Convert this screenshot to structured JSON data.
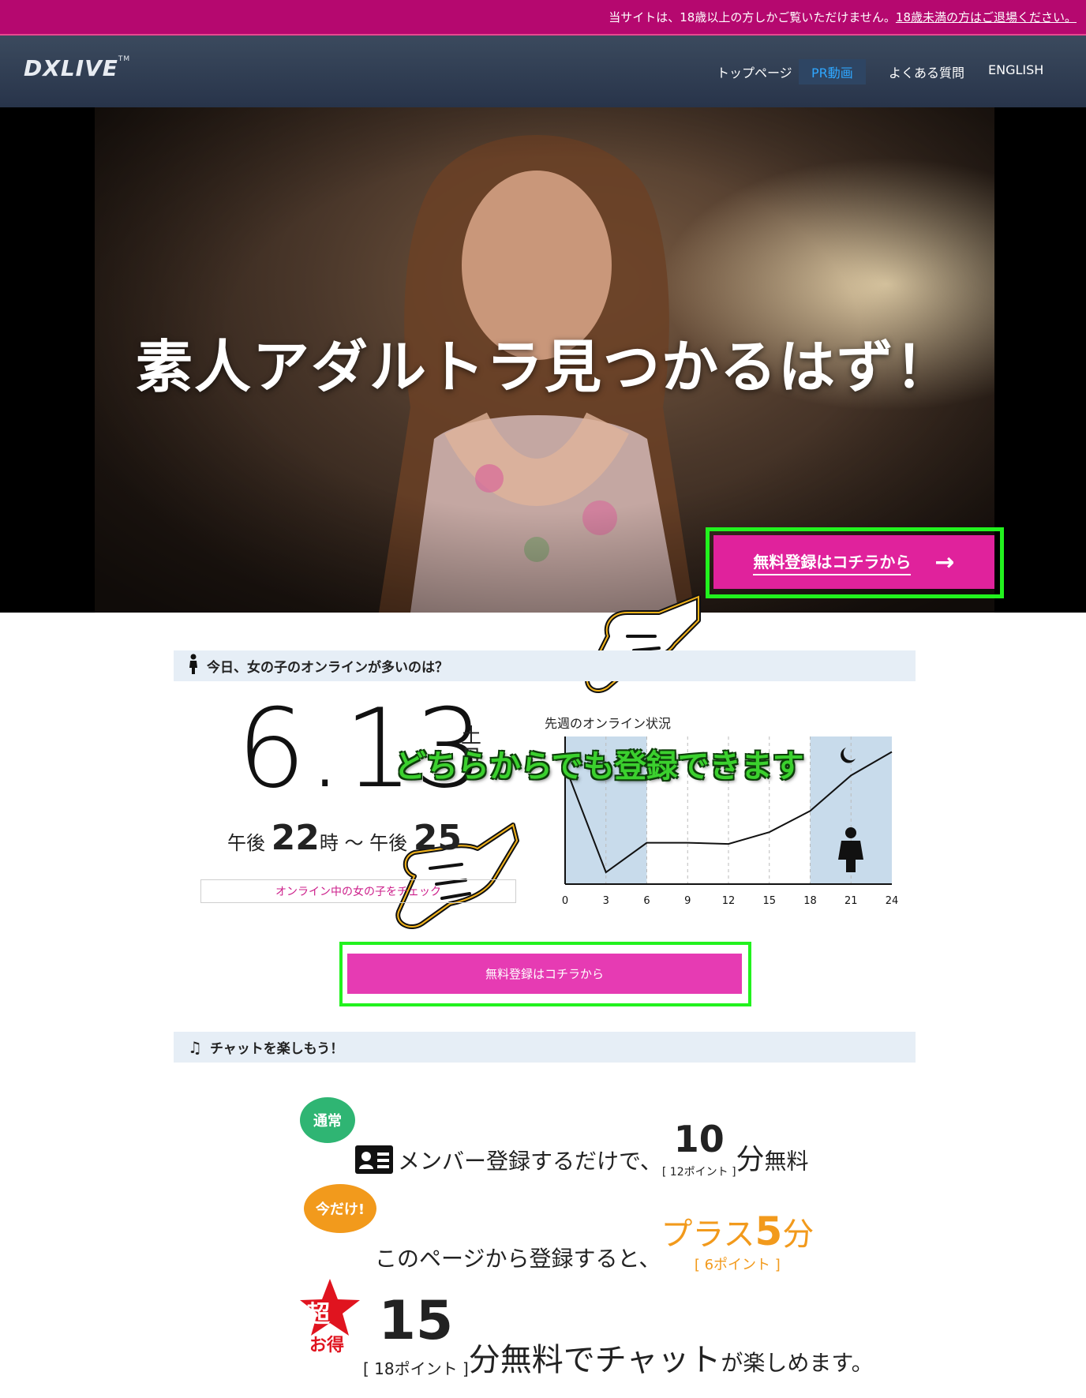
{
  "notice": {
    "text": "当サイトは、18歳以上の方しかご覧いただけません。",
    "exit_link": "18歳未満の方はご退場ください。"
  },
  "header": {
    "logo": "DXLIVE",
    "logo_tm": "TM",
    "nav": [
      "トップページ",
      "PR動画",
      "よくある質問",
      "ENGLISH"
    ]
  },
  "hero": {
    "headline": "素人アダルトラ見つかるはず！",
    "cta_label": "無料登録はコチラから",
    "cta_arrow": "→"
  },
  "online_section": {
    "title": "今日、女の子のオンラインが多いのは？",
    "date": "6.13",
    "weekday": "土日",
    "time_prefix": "午後",
    "time_start": "22",
    "time_unit": "時",
    "time_sep": "〜",
    "time_prefix2": "午後",
    "time_end": "25",
    "check_button": "オンライン中の女の子をチェック",
    "overlay_text": "どちらからでも登録できます",
    "cta_label": "無料登録はコチラから"
  },
  "chart_data": {
    "type": "line",
    "title": "先週のオンライン状況",
    "x": [
      0,
      3,
      6,
      9,
      12,
      15,
      18,
      21,
      24
    ],
    "values": [
      100,
      10,
      35,
      35,
      34,
      44,
      62,
      92,
      112
    ],
    "xticks": [
      "0",
      "3",
      "6",
      "9",
      "12",
      "15",
      "18",
      "21",
      "24"
    ],
    "night_bands": [
      [
        0,
        6
      ],
      [
        18,
        24
      ]
    ],
    "ylim": [
      0,
      125
    ],
    "band_color": "#c8dbeb",
    "line_color": "#111111"
  },
  "chat_section": {
    "title": "チャットを楽しもう！",
    "badge_normal": "通常",
    "line1_text": "メンバー登録するだけで、",
    "line1_num": "10",
    "line1_unit": "分",
    "line1_tail": "無料",
    "line1_points": "[ 12ポイント ]",
    "badge_now": "今だけ!",
    "line2_text": "このページから登録すると、",
    "line2_plus": "プラス",
    "line2_num": "5",
    "line2_unit": "分",
    "line2_points": "[ 6ポイント ]",
    "badge_super": "超",
    "badge_super_sub": "お得",
    "line3_num": "15",
    "line3_text": "分無料でチャット",
    "line3_tail": "が楽しめます。",
    "line3_points": "[ 18ポイント ]"
  }
}
